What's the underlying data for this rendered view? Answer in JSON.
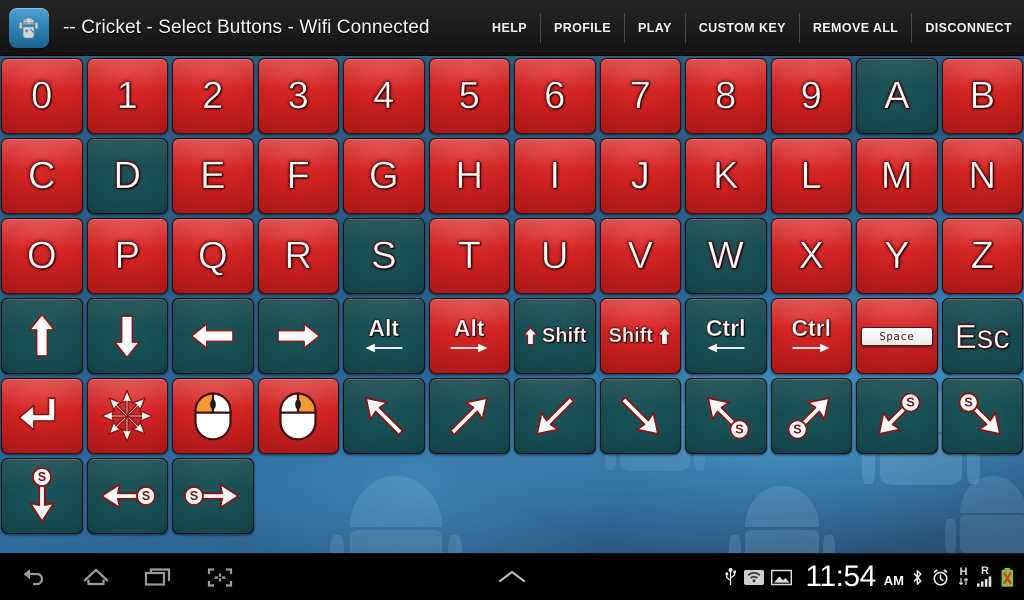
{
  "titlebar": {
    "app_icon": "android-gamepad-icon",
    "title": "-- Cricket - Select Buttons - Wifi Connected",
    "menu": [
      {
        "label": "HELP",
        "name": "help"
      },
      {
        "label": "PROFILE",
        "name": "profile"
      },
      {
        "label": "PLAY",
        "name": "play"
      },
      {
        "label": "CUSTOM KEY",
        "name": "custom-key"
      },
      {
        "label": "REMOVE ALL",
        "name": "remove-all"
      },
      {
        "label": "DISCONNECT",
        "name": "disconnect"
      }
    ]
  },
  "colors": {
    "key_unselected_red": "#cf2222",
    "key_selected_teal": "#15474c",
    "wallpaper_blue": "#2f6da0",
    "titlebar_dark": "#1b1b1b",
    "navbar_black": "#000000",
    "battery_warning": "#e03a2f",
    "signal_green": "#7dc242"
  },
  "keypad": {
    "columns": 12,
    "legend": {
      "red": "unselected",
      "teal": "selected"
    },
    "keys": [
      {
        "name": "key-0",
        "label": "0",
        "type": "char",
        "state": "red"
      },
      {
        "name": "key-1",
        "label": "1",
        "type": "char",
        "state": "red"
      },
      {
        "name": "key-2",
        "label": "2",
        "type": "char",
        "state": "red"
      },
      {
        "name": "key-3",
        "label": "3",
        "type": "char",
        "state": "red"
      },
      {
        "name": "key-4",
        "label": "4",
        "type": "char",
        "state": "red"
      },
      {
        "name": "key-5",
        "label": "5",
        "type": "char",
        "state": "red"
      },
      {
        "name": "key-6",
        "label": "6",
        "type": "char",
        "state": "red"
      },
      {
        "name": "key-7",
        "label": "7",
        "type": "char",
        "state": "red"
      },
      {
        "name": "key-8",
        "label": "8",
        "type": "char",
        "state": "red"
      },
      {
        "name": "key-9",
        "label": "9",
        "type": "char",
        "state": "red"
      },
      {
        "name": "key-a",
        "label": "A",
        "type": "char",
        "state": "teal"
      },
      {
        "name": "key-b",
        "label": "B",
        "type": "char",
        "state": "red"
      },
      {
        "name": "key-c",
        "label": "C",
        "type": "char",
        "state": "red"
      },
      {
        "name": "key-d",
        "label": "D",
        "type": "char",
        "state": "teal"
      },
      {
        "name": "key-e",
        "label": "E",
        "type": "char",
        "state": "red"
      },
      {
        "name": "key-f",
        "label": "F",
        "type": "char",
        "state": "red"
      },
      {
        "name": "key-g",
        "label": "G",
        "type": "char",
        "state": "red"
      },
      {
        "name": "key-h",
        "label": "H",
        "type": "char",
        "state": "red"
      },
      {
        "name": "key-i",
        "label": "I",
        "type": "char",
        "state": "red"
      },
      {
        "name": "key-j",
        "label": "J",
        "type": "char",
        "state": "red"
      },
      {
        "name": "key-k",
        "label": "K",
        "type": "char",
        "state": "red"
      },
      {
        "name": "key-l",
        "label": "L",
        "type": "char",
        "state": "red"
      },
      {
        "name": "key-m",
        "label": "M",
        "type": "char",
        "state": "red"
      },
      {
        "name": "key-n",
        "label": "N",
        "type": "char",
        "state": "red"
      },
      {
        "name": "key-o",
        "label": "O",
        "type": "char",
        "state": "red"
      },
      {
        "name": "key-p",
        "label": "P",
        "type": "char",
        "state": "red"
      },
      {
        "name": "key-q",
        "label": "Q",
        "type": "char",
        "state": "red"
      },
      {
        "name": "key-r",
        "label": "R",
        "type": "char",
        "state": "red"
      },
      {
        "name": "key-s",
        "label": "S",
        "type": "char",
        "state": "teal"
      },
      {
        "name": "key-t",
        "label": "T",
        "type": "char",
        "state": "red"
      },
      {
        "name": "key-u",
        "label": "U",
        "type": "char",
        "state": "red"
      },
      {
        "name": "key-v",
        "label": "V",
        "type": "char",
        "state": "red"
      },
      {
        "name": "key-w",
        "label": "W",
        "type": "char",
        "state": "teal"
      },
      {
        "name": "key-x",
        "label": "X",
        "type": "char",
        "state": "red"
      },
      {
        "name": "key-y",
        "label": "Y",
        "type": "char",
        "state": "red"
      },
      {
        "name": "key-z",
        "label": "Z",
        "type": "char",
        "state": "red"
      },
      {
        "name": "key-arrow-up",
        "label": "",
        "type": "arrow-up",
        "state": "teal"
      },
      {
        "name": "key-arrow-down",
        "label": "",
        "type": "arrow-down",
        "state": "teal"
      },
      {
        "name": "key-arrow-left",
        "label": "",
        "type": "arrow-left",
        "state": "teal"
      },
      {
        "name": "key-arrow-right",
        "label": "",
        "type": "arrow-right",
        "state": "teal"
      },
      {
        "name": "key-alt-left",
        "label": "Alt",
        "type": "mod-left",
        "state": "teal"
      },
      {
        "name": "key-alt-right",
        "label": "Alt",
        "type": "mod-right",
        "state": "red"
      },
      {
        "name": "key-shift-left",
        "label": "Shift",
        "type": "shift-left",
        "state": "teal"
      },
      {
        "name": "key-shift-right",
        "label": "Shift",
        "type": "shift-right",
        "state": "red"
      },
      {
        "name": "key-ctrl-left",
        "label": "Ctrl",
        "type": "mod-left",
        "state": "teal"
      },
      {
        "name": "key-ctrl-right",
        "label": "Ctrl",
        "type": "mod-right",
        "state": "red"
      },
      {
        "name": "key-space",
        "label": "Space",
        "type": "space",
        "state": "red"
      },
      {
        "name": "key-esc",
        "label": "Esc",
        "type": "word",
        "state": "teal"
      },
      {
        "name": "key-enter",
        "label": "",
        "type": "enter",
        "state": "red"
      },
      {
        "name": "key-move-all-directions",
        "label": "",
        "type": "star-arrows",
        "state": "red"
      },
      {
        "name": "key-mouse-left-click",
        "label": "",
        "type": "mouse-left",
        "state": "red"
      },
      {
        "name": "key-mouse-right-click",
        "label": "",
        "type": "mouse-right",
        "state": "red"
      },
      {
        "name": "key-diag-up-left",
        "label": "",
        "type": "diag-ul",
        "state": "teal"
      },
      {
        "name": "key-diag-up-right",
        "label": "",
        "type": "diag-ur",
        "state": "teal"
      },
      {
        "name": "key-diag-down-left",
        "label": "",
        "type": "diag-dl",
        "state": "teal"
      },
      {
        "name": "key-diag-down-right",
        "label": "",
        "type": "diag-dr",
        "state": "teal"
      },
      {
        "name": "key-scroll-diag-up-left",
        "label": "S",
        "type": "diag-ul-s",
        "state": "teal"
      },
      {
        "name": "key-scroll-diag-up-right",
        "label": "S",
        "type": "diag-ur-s",
        "state": "teal"
      },
      {
        "name": "key-scroll-diag-down-left",
        "label": "S",
        "type": "diag-dl-s",
        "state": "teal"
      },
      {
        "name": "key-scroll-diag-down-right",
        "label": "S",
        "type": "diag-dr-s",
        "state": "teal"
      },
      {
        "name": "key-scroll-down",
        "label": "S",
        "type": "s-down",
        "state": "teal"
      },
      {
        "name": "key-scroll-left",
        "label": "S",
        "type": "s-left",
        "state": "teal"
      },
      {
        "name": "key-scroll-right",
        "label": "S",
        "type": "s-right",
        "state": "teal"
      }
    ]
  },
  "navbar": {
    "buttons": [
      {
        "name": "back-icon",
        "label": "Back"
      },
      {
        "name": "home-icon",
        "label": "Home"
      },
      {
        "name": "recents-icon",
        "label": "Recent apps"
      },
      {
        "name": "screenshot-icon",
        "label": "Screenshot"
      }
    ],
    "expand_icon": "chevron-up-icon",
    "status": {
      "icons_left": [
        "usb-icon",
        "wifi-icon",
        "image-icon"
      ],
      "time": "11:54",
      "ampm": "AM",
      "icons_right": [
        "bluetooth-icon",
        "alarm-icon",
        "hsdpa-data-icon",
        "roaming-signal-icon",
        "battery-error-icon"
      ],
      "data_letter": "H",
      "roaming_letter": "R"
    }
  }
}
